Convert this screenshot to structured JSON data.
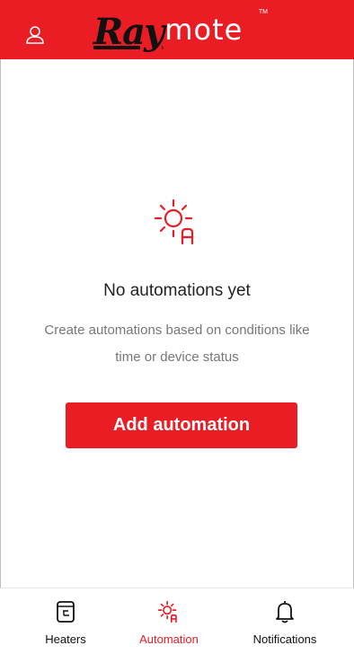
{
  "brand": {
    "logo_text_a": "Ray",
    "logo_text_b": "mote",
    "tm": "TM"
  },
  "header": {
    "user_icon": "user-icon"
  },
  "empty_state": {
    "icon": "sun-auto-icon",
    "title": "No automations yet",
    "description": "Create automations based on conditions like time or device status",
    "button_label": "Add automation"
  },
  "tabs": [
    {
      "label": "Heaters",
      "icon": "heater-icon",
      "active": false
    },
    {
      "label": "Automation",
      "icon": "automation-icon",
      "active": true
    },
    {
      "label": "Notifications",
      "icon": "bell-icon",
      "active": false
    }
  ],
  "colors": {
    "accent": "#ea1c24",
    "text": "#222222",
    "muted": "#777777"
  }
}
